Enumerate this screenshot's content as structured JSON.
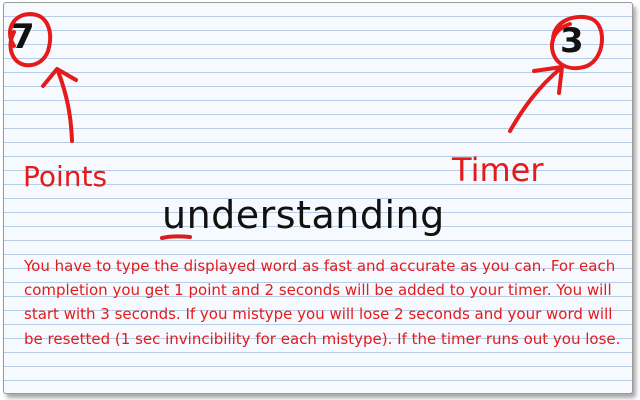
{
  "hud": {
    "points_value": "7",
    "timer_value": "3",
    "points_label": "Points",
    "timer_label": "Timer"
  },
  "word": {
    "typed": "u",
    "remaining": "nderstanding"
  },
  "instructions": "You have to type the displayed word as fast and accurate as you can. For each completion you get 1 point and 2 seconds will be added to your timer. You will start with 3 seconds. If you mistype you will lose 2 seconds and your word will be resetted (1 sec invincibility for each mistype). If the timer runs out you lose.",
  "colors": {
    "annotation": "#e51a1a",
    "text": "#111111",
    "paper": "#f6f9fd",
    "ruled_line": "#b9cde6"
  },
  "icons": {
    "points_arrow": "arrow-up-icon",
    "timer_arrow": "arrow-up-right-icon",
    "points_circle": "circle-highlight",
    "timer_circle": "circle-highlight",
    "cursor": "underline-cursor"
  }
}
